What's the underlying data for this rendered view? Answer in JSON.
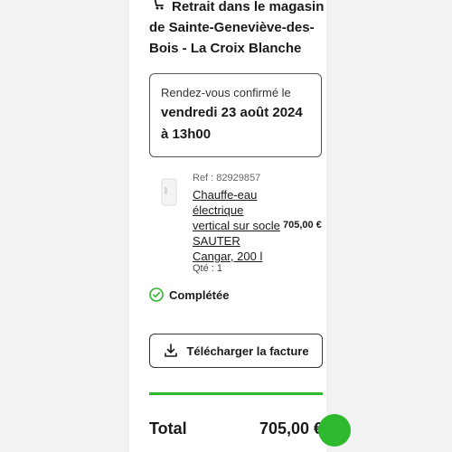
{
  "pickup": {
    "title": "Retrait dans le magasin de Sainte-Geneviève-des-Bois - La Croix Blanche",
    "icon": "pickup-icon"
  },
  "appointment": {
    "label": "Rendez-vous confirmé le",
    "date": "vendredi 23 août 2024 à 13h00"
  },
  "product": {
    "ref": "Ref : 82929857",
    "name": "Chauffe-eau électrique vertical sur socle SAUTER Cangar, 200 l",
    "price": "705,00 €",
    "qty": "Qté : 1"
  },
  "status": {
    "label": "Complétée",
    "icon": "check-circle-icon",
    "color": "#2eb82e"
  },
  "invoice": {
    "label": "Télécharger la facture",
    "icon": "download-icon"
  },
  "total": {
    "label": "Total",
    "value": "705,00 €"
  },
  "colors": {
    "accent": "#2eb82e",
    "text": "#1a1a1a",
    "background": "#ffffff"
  }
}
